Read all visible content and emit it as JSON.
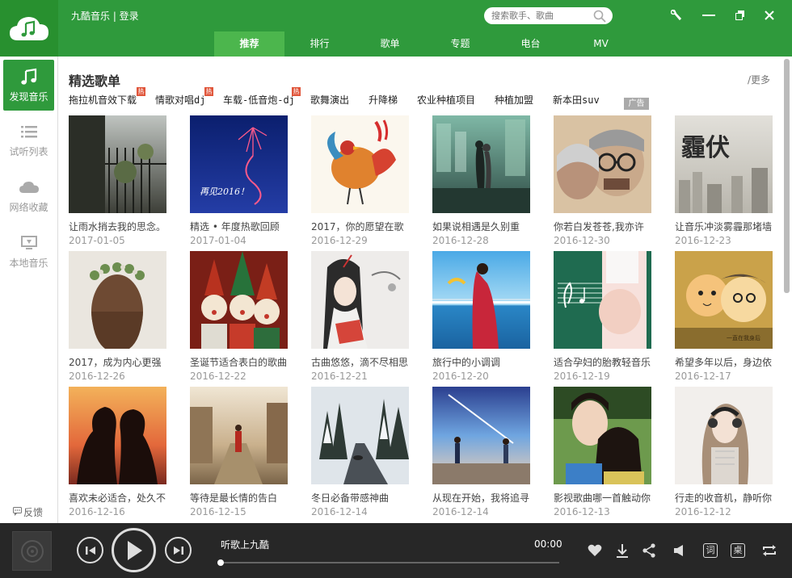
{
  "header": {
    "title": "九酷音乐 | 登录",
    "search_placeholder": "搜索歌手、歌曲"
  },
  "nav": {
    "tabs": [
      {
        "label": "推荐",
        "active": true
      },
      {
        "label": "排行"
      },
      {
        "label": "歌单"
      },
      {
        "label": "专题"
      },
      {
        "label": "电台"
      },
      {
        "label": "MV"
      }
    ]
  },
  "sidebar": {
    "items": [
      {
        "label": "发现音乐",
        "icon": "music-note-icon",
        "active": true
      },
      {
        "label": "试听列表",
        "icon": "list-icon"
      },
      {
        "label": "网络收藏",
        "icon": "cloud-icon"
      },
      {
        "label": "本地音乐",
        "icon": "monitor-icon"
      }
    ],
    "feedback": "反馈"
  },
  "main": {
    "section_title": "精选歌单",
    "more": "/更多",
    "tags": [
      {
        "label": "拖拉机音效下载",
        "hot": true
      },
      {
        "label": "情歌对唱dj",
        "hot": true
      },
      {
        "label": "车载-低音炮-dj",
        "hot": true
      },
      {
        "label": "歌舞演出"
      },
      {
        "label": "升降梯"
      },
      {
        "label": "农业种植项目"
      },
      {
        "label": "种植加盟"
      },
      {
        "label": "新本田suv"
      }
    ],
    "hot_label": "热",
    "ad_label": "广告",
    "playlists": [
      {
        "title": "让雨水捎去我的思念。",
        "date": "2017-01-05"
      },
      {
        "title": "精选 • 年度热歌回顾",
        "date": "2017-01-04"
      },
      {
        "title": "2017，你的愿望在歌",
        "date": "2016-12-29"
      },
      {
        "title": "如果说相遇是久别重",
        "date": "2016-12-28"
      },
      {
        "title": "你若白发苍苍,我亦许",
        "date": "2016-12-30"
      },
      {
        "title": "让音乐冲淡雾霾那堵墙",
        "date": "2016-12-23"
      },
      {
        "title": "2017，成为内心更强",
        "date": "2016-12-26"
      },
      {
        "title": "圣诞节适合表白的歌曲",
        "date": "2016-12-22"
      },
      {
        "title": "古曲悠悠，滴不尽相思",
        "date": "2016-12-21"
      },
      {
        "title": "旅行中的小调调",
        "date": "2016-12-20"
      },
      {
        "title": "适合孕妇的胎教轻音乐",
        "date": "2016-12-19"
      },
      {
        "title": "希望多年以后，身边依",
        "date": "2016-12-17"
      },
      {
        "title": "喜欢未必适合，处久不",
        "date": "2016-12-16"
      },
      {
        "title": "等待是最长情的告白",
        "date": "2016-12-15"
      },
      {
        "title": "冬日必备带感神曲",
        "date": "2016-12-14"
      },
      {
        "title": "从现在开始，我将追寻",
        "date": "2016-12-14"
      },
      {
        "title": "影视歌曲哪一首触动你",
        "date": "2016-12-13"
      },
      {
        "title": "行走的收音机，静听你",
        "date": "2016-12-12"
      }
    ],
    "thumb_text": {
      "card2": "再见2016！",
      "card6": "霾伏",
      "card11": "一直在我身后"
    }
  },
  "player": {
    "song": "听歌上九酷",
    "time": "00:00",
    "progress": 0,
    "lyric_label": "词",
    "desk_label": "桌"
  },
  "colors": {
    "brand": "#2f9a3c",
    "brand_dark": "#28902f",
    "tab_active": "#4cb64d",
    "player_bg": "#272727",
    "hot": "#e0553a"
  }
}
